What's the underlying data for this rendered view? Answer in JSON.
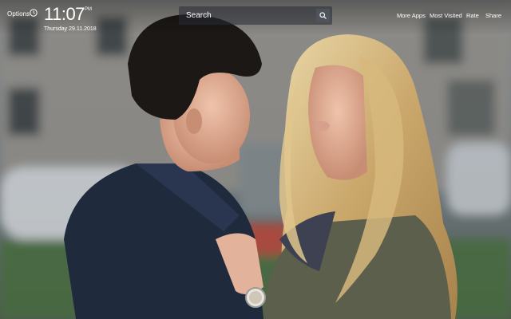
{
  "header": {
    "options_label": "Options",
    "clock_icon": "clock-icon",
    "time": "11:07",
    "ampm": "PM",
    "date": "Thursday 29.11.2018"
  },
  "search": {
    "placeholder": "Search",
    "icon": "search-icon"
  },
  "nav": {
    "more_apps": "More Apps",
    "most_visited": "Most Visited",
    "rate": "Rate",
    "share": "Share"
  }
}
